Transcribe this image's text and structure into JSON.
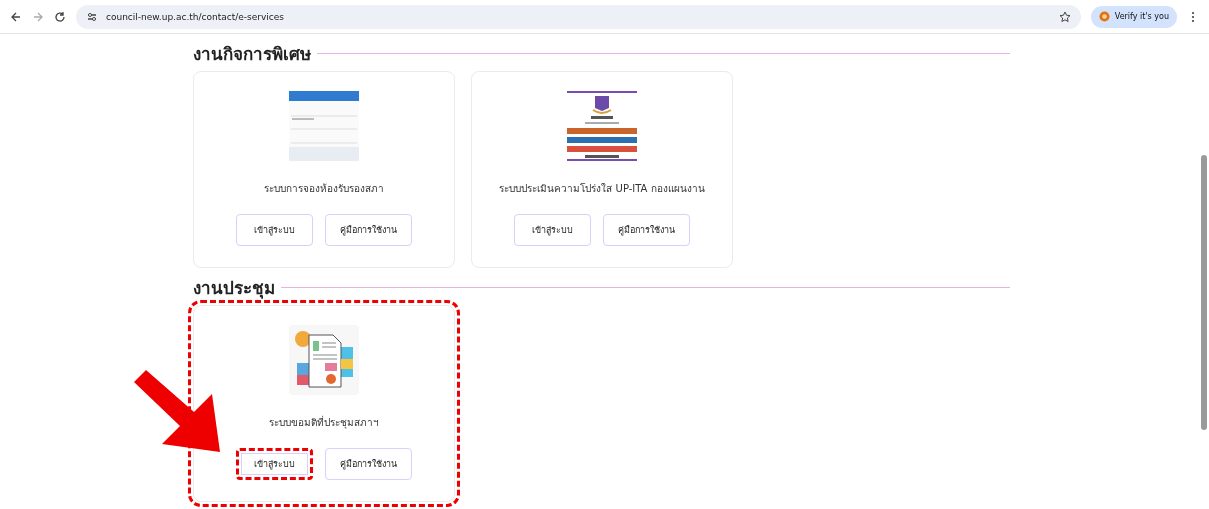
{
  "browser": {
    "url": "council-new.up.ac.th/contact/e-services",
    "profile_button": "Verify it's you"
  },
  "sections": [
    {
      "title": "งานกิจการพิเศษ",
      "cards": [
        {
          "kind": "form",
          "caption": "ระบบการจองห้องรับรองสภา",
          "highlighted": false,
          "buttons": [
            {
              "label": "เข้าสู่ระบบ",
              "highlighted": false
            },
            {
              "label": "คู่มือการใช้งาน",
              "highlighted": false
            }
          ]
        },
        {
          "kind": "portal",
          "caption": "ระบบประเมินความโปร่งใส UP-ITA กองแผนงาน",
          "highlighted": false,
          "buttons": [
            {
              "label": "เข้าสู่ระบบ",
              "highlighted": false
            },
            {
              "label": "คู่มือการใช้งาน",
              "highlighted": false
            }
          ]
        }
      ]
    },
    {
      "title": "งานประชุม",
      "cards": [
        {
          "kind": "documents",
          "caption": "ระบบขอมติที่ประชุมสภาฯ",
          "highlighted": true,
          "buttons": [
            {
              "label": "เข้าสู่ระบบ",
              "highlighted": true
            },
            {
              "label": "คู่มือการใช้งาน",
              "highlighted": false
            }
          ]
        }
      ]
    }
  ],
  "pointer_arrow": true
}
